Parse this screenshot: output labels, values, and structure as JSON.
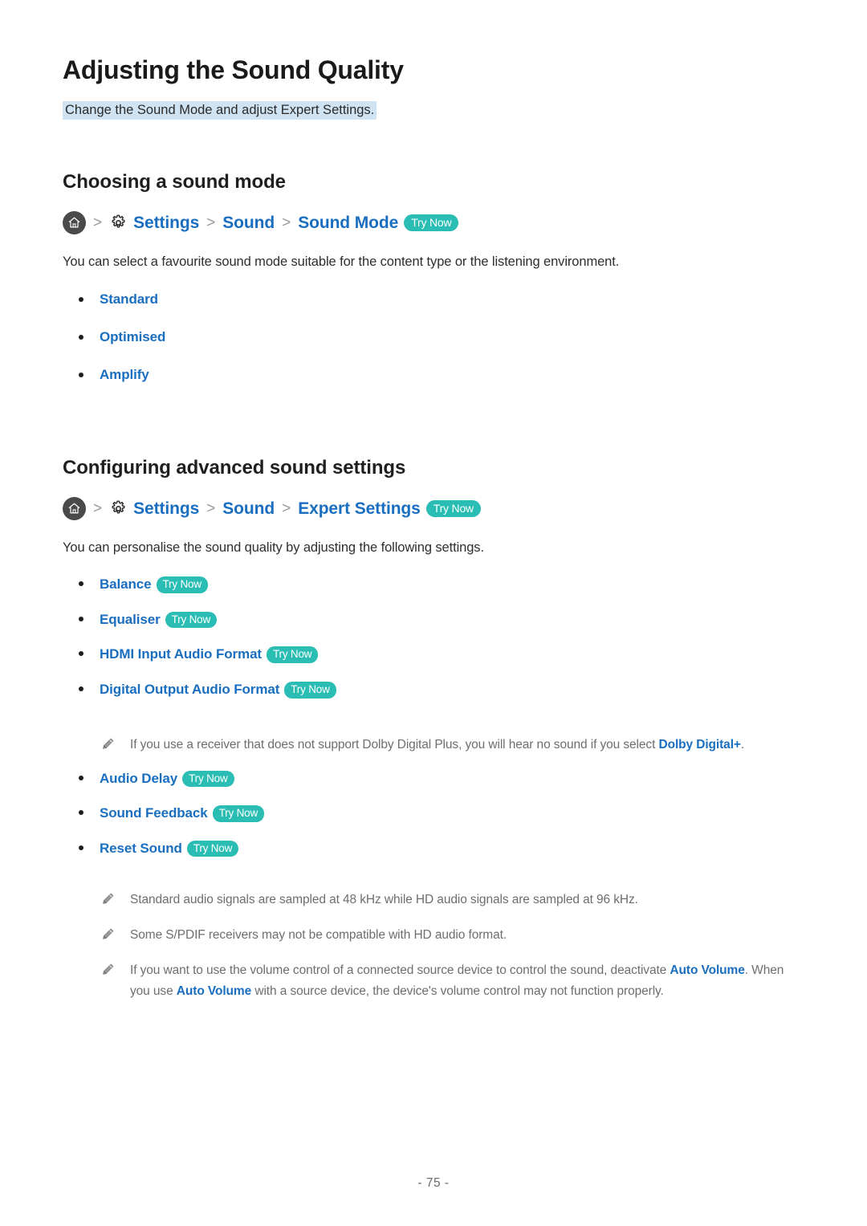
{
  "page": {
    "title": "Adjusting the Sound Quality",
    "subtitle": "Change the Sound Mode and adjust Expert Settings.",
    "page_number": "- 75 -",
    "accent_blue": "#1a6ec0",
    "accent_teal": "#29bdb3",
    "highlight_blue": "#cfe3f3",
    "note_gray": "#6e6e6e"
  },
  "icons": {
    "home": "home-icon",
    "gear": "gear-icon",
    "chevron": ">",
    "pencil": "pencil-icon"
  },
  "sections": [
    {
      "heading": "Choosing a sound mode",
      "breadcrumb": {
        "home_label": "Home",
        "sep1": ">",
        "settings": "Settings",
        "sep2": ">",
        "sound": "Sound",
        "sep3": ">",
        "target": "Sound Mode",
        "try_now": "Try Now"
      },
      "paragraph": "You can select a favourite sound mode suitable for the content type or the listening environment.",
      "items": [
        {
          "label": "Standard",
          "try_now": null
        },
        {
          "label": "Optimised",
          "try_now": null
        },
        {
          "label": "Amplify",
          "try_now": null
        }
      ]
    },
    {
      "heading": "Configuring advanced sound settings",
      "breadcrumb": {
        "home_label": "Home",
        "sep1": ">",
        "settings": "Settings",
        "sep2": ">",
        "sound": "Sound",
        "sep3": ">",
        "target": "Expert Settings",
        "try_now": "Try Now"
      },
      "paragraph": "You can personalise the sound quality by adjusting the following settings.",
      "items_group_1": [
        {
          "label": "Balance",
          "try_now": "Try Now"
        },
        {
          "label": "Equaliser",
          "try_now": "Try Now"
        },
        {
          "label": "HDMI Input Audio Format",
          "try_now": "Try Now"
        },
        {
          "label": "Digital Output Audio Format",
          "try_now": "Try Now"
        }
      ],
      "note_after_group_1": {
        "text_before": "If you use a receiver that does not support Dolby Digital Plus, you will hear no sound if you select ",
        "emphasis": "Dolby Digital+",
        "text_after": "."
      },
      "items_group_2": [
        {
          "label": "Audio Delay",
          "try_now": "Try Now"
        },
        {
          "label": "Sound Feedback",
          "try_now": "Try Now"
        },
        {
          "label": "Reset Sound",
          "try_now": "Try Now"
        }
      ],
      "notes_final": [
        {
          "text_before": "Standard audio signals are sampled at 48 kHz while HD audio signals are sampled at 96 kHz.",
          "emphasis": "",
          "text_after": ""
        },
        {
          "text_before": "Some S/PDIF receivers may not be compatible with HD audio format.",
          "emphasis": "",
          "text_after": ""
        },
        {
          "text_before": "If you want to use the volume control of a connected source device to control the sound, deactivate ",
          "emphasis": "Auto Volume",
          "text_after": ". When you use ",
          "emphasis2": "Auto Volume",
          "text_after2": " with a source device, the device's volume control may not function properly."
        }
      ]
    }
  ]
}
